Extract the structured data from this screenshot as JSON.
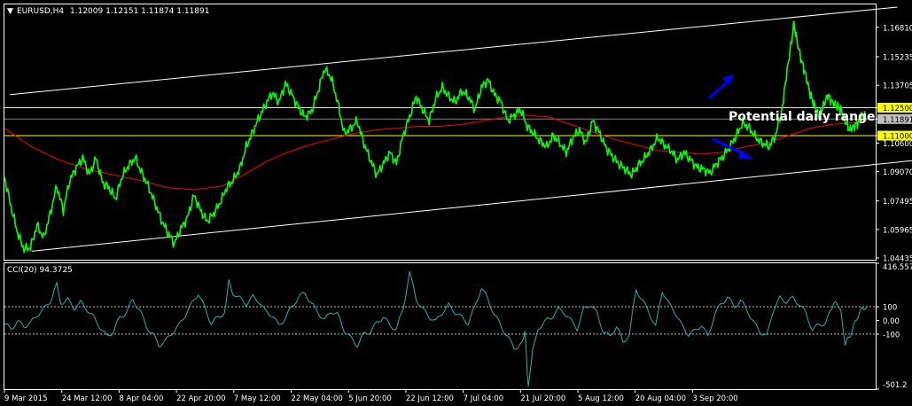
{
  "header": {
    "triangle": "▼",
    "symbol": "EURUSD,H4",
    "ohlc": "1.12009 1.12151 1.11874 1.11891"
  },
  "indicator_label": "CCI(20) 94.3725",
  "annotation": "Potential daily range",
  "colors": {
    "background": "#000000",
    "price": "#00ff00",
    "ma": "#ff0000",
    "channel": "#ffffff",
    "range": "#ffff00",
    "cci": "#20b2aa",
    "arrow": "#0000ff",
    "axis": "#ffffff",
    "current_price_tag": "#c0c0c0"
  },
  "chart_data": [
    {
      "type": "line",
      "name": "EURUSD H4 price",
      "ylim": [
        1.04435,
        1.179
      ],
      "y_ticks": [
        "1.16810",
        "1.15235",
        "1.13705",
        "1.12500",
        "1.11891",
        "1.11000",
        "1.10600",
        "1.09070",
        "1.07495",
        "1.05965",
        "1.04435"
      ],
      "y_tick_values": [
        1.1681,
        1.15235,
        1.13705,
        1.125,
        1.11891,
        1.11,
        1.106,
        1.0907,
        1.07495,
        1.05965,
        1.04435
      ],
      "x_ticks": [
        "9 Mar 2015",
        "24 Mar 12:00",
        "8 Apr 04:00",
        "22 Apr 20:00",
        "7 May 12:00",
        "22 May 04:00",
        "5 Jun 20:00",
        "22 Jun 12:00",
        "7 Jul 04:00",
        "21 Jul 20:00",
        "5 Aug 12:00",
        "20 Aug 04:00",
        "3 Sep 20:00"
      ],
      "price_path": [
        [
          0,
          1.088
        ],
        [
          6,
          1.072
        ],
        [
          12,
          1.058
        ],
        [
          18,
          1.049
        ],
        [
          24,
          1.05
        ],
        [
          30,
          1.062
        ],
        [
          36,
          1.055
        ],
        [
          42,
          1.068
        ],
        [
          48,
          1.083
        ],
        [
          54,
          1.07
        ],
        [
          60,
          1.086
        ],
        [
          66,
          1.093
        ],
        [
          72,
          1.098
        ],
        [
          78,
          1.089
        ],
        [
          84,
          1.098
        ],
        [
          90,
          1.085
        ],
        [
          96,
          1.082
        ],
        [
          102,
          1.076
        ],
        [
          108,
          1.088
        ],
        [
          114,
          1.094
        ],
        [
          120,
          1.098
        ],
        [
          126,
          1.09
        ],
        [
          132,
          1.083
        ],
        [
          138,
          1.074
        ],
        [
          144,
          1.065
        ],
        [
          150,
          1.058
        ],
        [
          156,
          1.052
        ],
        [
          162,
          1.06
        ],
        [
          168,
          1.066
        ],
        [
          174,
          1.078
        ],
        [
          180,
          1.07
        ],
        [
          186,
          1.064
        ],
        [
          192,
          1.068
        ],
        [
          198,
          1.074
        ],
        [
          204,
          1.082
        ],
        [
          210,
          1.086
        ],
        [
          216,
          1.092
        ],
        [
          222,
          1.104
        ],
        [
          228,
          1.112
        ],
        [
          234,
          1.12
        ],
        [
          240,
          1.127
        ],
        [
          246,
          1.133
        ],
        [
          252,
          1.128
        ],
        [
          258,
          1.138
        ],
        [
          264,
          1.132
        ],
        [
          270,
          1.125
        ],
        [
          276,
          1.12
        ],
        [
          282,
          1.123
        ],
        [
          288,
          1.134
        ],
        [
          294,
          1.146
        ],
        [
          300,
          1.141
        ],
        [
          306,
          1.128
        ],
        [
          312,
          1.111
        ],
        [
          318,
          1.114
        ],
        [
          324,
          1.118
        ],
        [
          330,
          1.106
        ],
        [
          336,
          1.097
        ],
        [
          342,
          1.089
        ],
        [
          348,
          1.095
        ],
        [
          354,
          1.101
        ],
        [
          360,
          1.095
        ],
        [
          366,
          1.11
        ],
        [
          372,
          1.12
        ],
        [
          378,
          1.131
        ],
        [
          384,
          1.124
        ],
        [
          390,
          1.118
        ],
        [
          396,
          1.13
        ],
        [
          402,
          1.136
        ],
        [
          408,
          1.131
        ],
        [
          414,
          1.128
        ],
        [
          420,
          1.134
        ],
        [
          426,
          1.131
        ],
        [
          432,
          1.124
        ],
        [
          438,
          1.136
        ],
        [
          444,
          1.14
        ],
        [
          450,
          1.132
        ],
        [
          456,
          1.128
        ],
        [
          462,
          1.118
        ],
        [
          468,
          1.121
        ],
        [
          474,
          1.124
        ],
        [
          480,
          1.115
        ],
        [
          486,
          1.111
        ],
        [
          492,
          1.107
        ],
        [
          498,
          1.104
        ],
        [
          504,
          1.11
        ],
        [
          510,
          1.106
        ],
        [
          516,
          1.101
        ],
        [
          522,
          1.109
        ],
        [
          528,
          1.113
        ],
        [
          534,
          1.106
        ],
        [
          540,
          1.118
        ],
        [
          546,
          1.112
        ],
        [
          552,
          1.104
        ],
        [
          558,
          1.099
        ],
        [
          564,
          1.095
        ],
        [
          570,
          1.092
        ],
        [
          576,
          1.089
        ],
        [
          582,
          1.094
        ],
        [
          588,
          1.098
        ],
        [
          594,
          1.103
        ],
        [
          600,
          1.109
        ],
        [
          606,
          1.105
        ],
        [
          612,
          1.102
        ],
        [
          618,
          1.097
        ],
        [
          624,
          1.101
        ],
        [
          630,
          1.097
        ],
        [
          636,
          1.093
        ],
        [
          642,
          1.092
        ],
        [
          648,
          1.09
        ],
        [
          654,
          1.095
        ],
        [
          660,
          1.099
        ],
        [
          666,
          1.104
        ],
        [
          672,
          1.11
        ],
        [
          678,
          1.117
        ],
        [
          684,
          1.114
        ],
        [
          690,
          1.109
        ],
        [
          696,
          1.106
        ],
        [
          702,
          1.104
        ],
        [
          708,
          1.11
        ],
        [
          714,
          1.124
        ],
        [
          718,
          1.142
        ],
        [
          722,
          1.158
        ],
        [
          725,
          1.17
        ],
        [
          728,
          1.16
        ],
        [
          732,
          1.15
        ],
        [
          736,
          1.142
        ],
        [
          740,
          1.132
        ],
        [
          744,
          1.126
        ],
        [
          748,
          1.12
        ],
        [
          752,
          1.126
        ],
        [
          756,
          1.132
        ],
        [
          760,
          1.128
        ],
        [
          764,
          1.126
        ],
        [
          768,
          1.124
        ],
        [
          772,
          1.118
        ],
        [
          776,
          1.113
        ],
        [
          780,
          1.115
        ],
        [
          784,
          1.117
        ],
        [
          788,
          1.121
        ],
        [
          792,
          1.119
        ]
      ],
      "moving_average": [
        [
          0,
          1.114
        ],
        [
          25,
          1.104
        ],
        [
          50,
          1.097
        ],
        [
          75,
          1.092
        ],
        [
          100,
          1.089
        ],
        [
          125,
          1.086
        ],
        [
          150,
          1.082
        ],
        [
          175,
          1.081
        ],
        [
          200,
          1.083
        ],
        [
          220,
          1.089
        ],
        [
          240,
          1.096
        ],
        [
          260,
          1.101
        ],
        [
          280,
          1.105
        ],
        [
          300,
          1.108
        ],
        [
          320,
          1.111
        ],
        [
          340,
          1.113
        ],
        [
          360,
          1.114
        ],
        [
          380,
          1.115
        ],
        [
          400,
          1.115
        ],
        [
          420,
          1.116
        ],
        [
          440,
          1.118
        ],
        [
          460,
          1.12
        ],
        [
          480,
          1.121
        ],
        [
          500,
          1.12
        ],
        [
          520,
          1.116
        ],
        [
          540,
          1.112
        ],
        [
          560,
          1.108
        ],
        [
          580,
          1.105
        ],
        [
          600,
          1.102
        ],
        [
          620,
          1.101
        ],
        [
          640,
          1.1
        ],
        [
          660,
          1.101
        ],
        [
          680,
          1.104
        ],
        [
          700,
          1.106
        ],
        [
          720,
          1.11
        ],
        [
          740,
          1.114
        ],
        [
          760,
          1.116
        ],
        [
          780,
          1.117
        ],
        [
          792,
          1.118
        ]
      ],
      "channel_upper": [
        [
          5,
          1.132
        ],
        [
          820,
          1.179
        ]
      ],
      "channel_lower": [
        [
          25,
          1.048
        ],
        [
          990,
          1.106
        ]
      ],
      "range_high": 1.125,
      "range_low": 1.11,
      "current_price": 1.11891
    },
    {
      "type": "line",
      "name": "CCI(20)",
      "ylim": [
        -501.2,
        416.6
      ],
      "y_ticks": [
        "416.557",
        "100",
        "0.00",
        "-100",
        "-501.2"
      ],
      "y_tick_values": [
        416.557,
        100,
        0,
        -100,
        -501.2
      ],
      "levels": [
        100,
        -100
      ],
      "cci_path": [
        [
          0,
          -30
        ],
        [
          6,
          -60
        ],
        [
          12,
          -10
        ],
        [
          18,
          -40
        ],
        [
          24,
          -20
        ],
        [
          30,
          40
        ],
        [
          36,
          80
        ],
        [
          42,
          140
        ],
        [
          48,
          260
        ],
        [
          52,
          130
        ],
        [
          58,
          150
        ],
        [
          64,
          90
        ],
        [
          70,
          130
        ],
        [
          76,
          80
        ],
        [
          82,
          20
        ],
        [
          88,
          -50
        ],
        [
          94,
          -120
        ],
        [
          100,
          -80
        ],
        [
          106,
          20
        ],
        [
          112,
          60
        ],
        [
          118,
          150
        ],
        [
          124,
          80
        ],
        [
          130,
          -40
        ],
        [
          136,
          -100
        ],
        [
          142,
          -180
        ],
        [
          148,
          -150
        ],
        [
          154,
          -90
        ],
        [
          160,
          -40
        ],
        [
          166,
          40
        ],
        [
          172,
          120
        ],
        [
          178,
          200
        ],
        [
          184,
          90
        ],
        [
          190,
          -20
        ],
        [
          196,
          20
        ],
        [
          202,
          60
        ],
        [
          206,
          280
        ],
        [
          210,
          200
        ],
        [
          216,
          160
        ],
        [
          222,
          120
        ],
        [
          228,
          170
        ],
        [
          234,
          140
        ],
        [
          240,
          60
        ],
        [
          246,
          40
        ],
        [
          252,
          -40
        ],
        [
          258,
          20
        ],
        [
          264,
          100
        ],
        [
          270,
          170
        ],
        [
          276,
          200
        ],
        [
          282,
          120
        ],
        [
          288,
          60
        ],
        [
          294,
          0
        ],
        [
          300,
          70
        ],
        [
          306,
          40
        ],
        [
          312,
          -70
        ],
        [
          318,
          -130
        ],
        [
          324,
          -180
        ],
        [
          330,
          -100
        ],
        [
          336,
          -80
        ],
        [
          342,
          -20
        ],
        [
          348,
          30
        ],
        [
          354,
          -40
        ],
        [
          360,
          -60
        ],
        [
          366,
          80
        ],
        [
          372,
          350
        ],
        [
          378,
          160
        ],
        [
          384,
          80
        ],
        [
          390,
          30
        ],
        [
          396,
          -10
        ],
        [
          402,
          60
        ],
        [
          408,
          110
        ],
        [
          414,
          60
        ],
        [
          420,
          20
        ],
        [
          426,
          -20
        ],
        [
          432,
          100
        ],
        [
          438,
          240
        ],
        [
          444,
          150
        ],
        [
          450,
          40
        ],
        [
          456,
          -40
        ],
        [
          462,
          -120
        ],
        [
          468,
          -200
        ],
        [
          474,
          -180
        ],
        [
          478,
          -80
        ],
        [
          481,
          -500
        ],
        [
          485,
          -200
        ],
        [
          490,
          -60
        ],
        [
          496,
          -10
        ],
        [
          502,
          20
        ],
        [
          508,
          80
        ],
        [
          514,
          60
        ],
        [
          520,
          0
        ],
        [
          526,
          -60
        ],
        [
          532,
          80
        ],
        [
          538,
          120
        ],
        [
          544,
          50
        ],
        [
          550,
          -80
        ],
        [
          556,
          -120
        ],
        [
          562,
          -40
        ],
        [
          568,
          -160
        ],
        [
          574,
          -100
        ],
        [
          580,
          230
        ],
        [
          586,
          140
        ],
        [
          592,
          60
        ],
        [
          598,
          -50
        ],
        [
          604,
          220
        ],
        [
          610,
          120
        ],
        [
          616,
          60
        ],
        [
          622,
          -40
        ],
        [
          628,
          -100
        ],
        [
          634,
          -80
        ],
        [
          640,
          -30
        ],
        [
          646,
          -120
        ],
        [
          652,
          40
        ],
        [
          658,
          120
        ],
        [
          664,
          170
        ],
        [
          670,
          100
        ],
        [
          676,
          140
        ],
        [
          682,
          80
        ],
        [
          688,
          -20
        ],
        [
          694,
          -80
        ],
        [
          700,
          -120
        ],
        [
          706,
          80
        ],
        [
          712,
          160
        ],
        [
          718,
          140
        ],
        [
          724,
          160
        ],
        [
          730,
          120
        ],
        [
          736,
          50
        ],
        [
          742,
          -70
        ],
        [
          748,
          -30
        ],
        [
          754,
          -20
        ],
        [
          760,
          90
        ],
        [
          764,
          140
        ],
        [
          768,
          60
        ],
        [
          772,
          -170
        ],
        [
          776,
          -120
        ],
        [
          780,
          -40
        ],
        [
          784,
          40
        ],
        [
          788,
          90
        ],
        [
          792,
          100
        ]
      ]
    }
  ]
}
